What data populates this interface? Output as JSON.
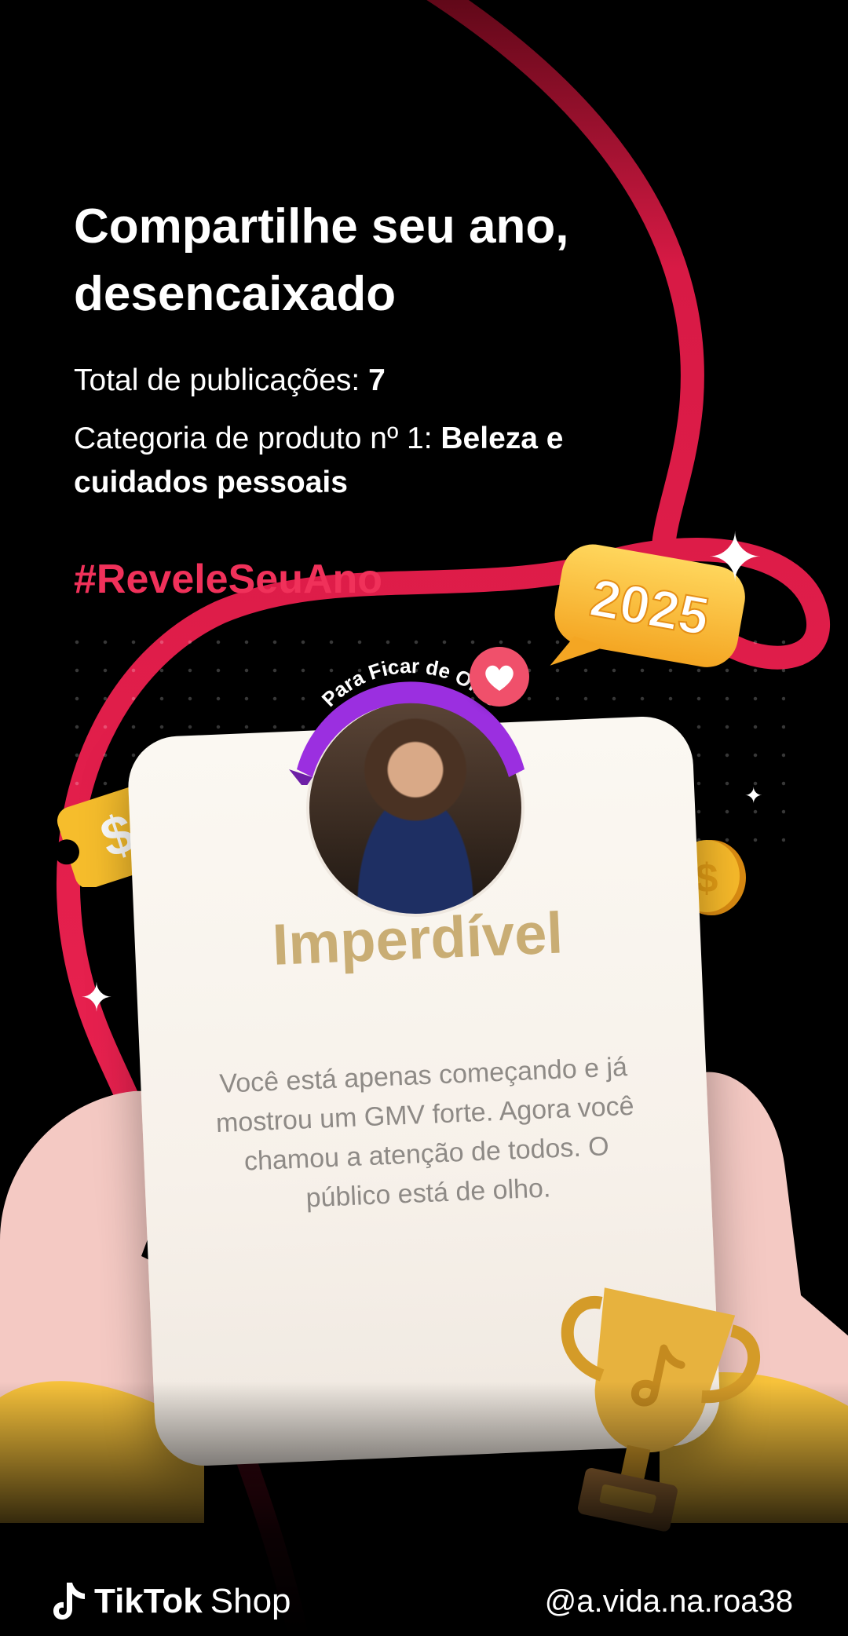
{
  "headline": "Compartilhe seu ano, desencaixado",
  "stats": [
    {
      "label": "Total de publicações: ",
      "value": "7"
    },
    {
      "label": "Categoria de produto nº 1: ",
      "value": "Beleza e cuidados pessoais"
    }
  ],
  "hashtag": "#ReveleSeuAno",
  "year_bubble": "2025",
  "badge": {
    "text": "Para Ficar de Olho"
  },
  "card": {
    "title": "Imperdível",
    "body": "Você está apenas começando e já mostrou um GMV forte. Agora você chamou a atenção de todos. O público está de olho."
  },
  "footer": {
    "brand_name": "TikTok",
    "brand_suffix": "Shop",
    "handle": "@a.vida.na.roa38"
  },
  "icons": [
    "tiktok-logo-icon",
    "heart-icon",
    "dollar-ticket-icon",
    "coin-icon",
    "trophy-icon",
    "sparkle-icon",
    "speech-bubble-icon"
  ],
  "colors": {
    "accent": "#e8214f",
    "hashtag": "#f0315a",
    "card_title": "#c9ad74",
    "badge": "#9b2fe0"
  }
}
